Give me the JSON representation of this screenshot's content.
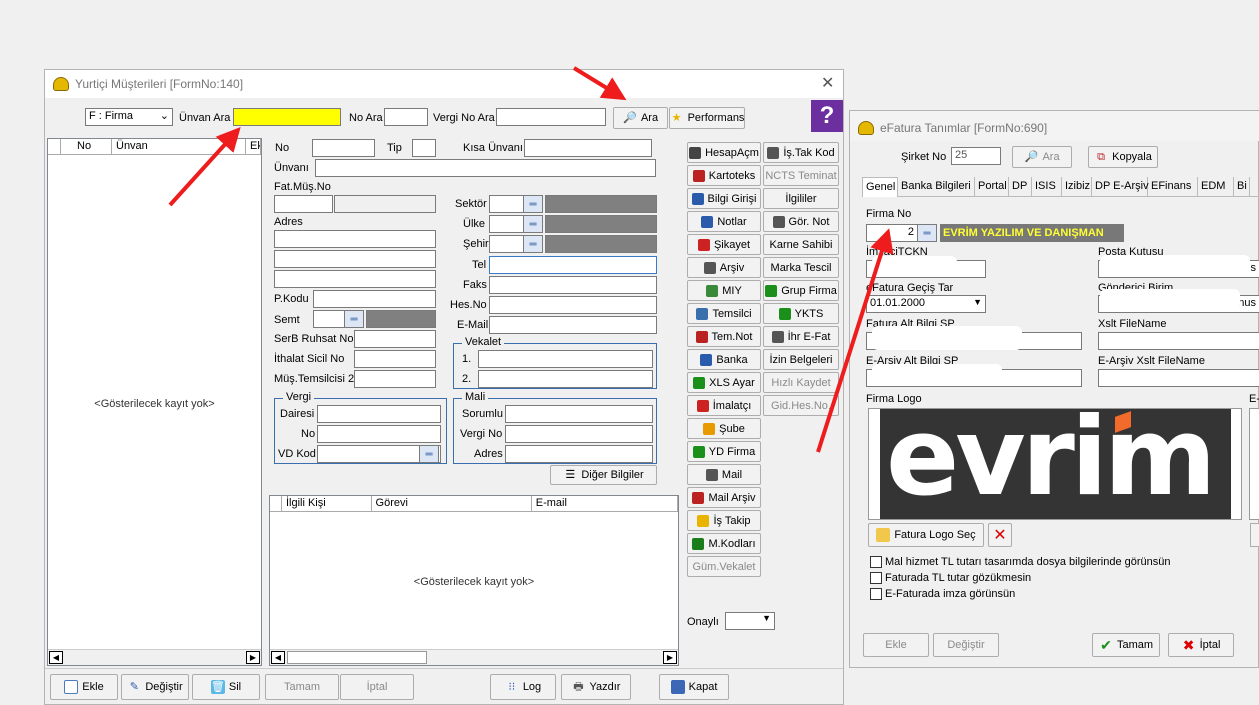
{
  "w1": {
    "title": "Yurtiçi Müşterileri [FormNo:140]",
    "filter_select": "F : Firma",
    "unvan_ara": "Ünvan Ara",
    "no_ara": "No Ara",
    "vergi_no_ara": "Vergi No Ara",
    "ara": "Ara",
    "performans": "Performans",
    "grid1_cols": [
      "No",
      "Ünvan",
      "Ek"
    ],
    "empty": "<Gösterilecek kayıt yok>",
    "f": {
      "no": "No",
      "tip": "Tip",
      "kisa_unvani": "Kısa Ünvanı",
      "unvani": "Ünvanı",
      "fat_mus_no": "Fat.Müş.No",
      "adres": "Adres",
      "sektor": "Sektör",
      "ulke": "Ülke",
      "sehir": "Şehir",
      "tel": "Tel",
      "faks": "Faks",
      "hes_no": "Hes.No",
      "email": "E-Mail",
      "pkodu": "P.Kodu",
      "semt": "Semt",
      "serb": "SerB Ruhsat No",
      "ithalat": "İthalat Sicil No",
      "mus_tem": "Müş.Temsilcisi 2",
      "vergi": "Vergi",
      "dairesi": "Dairesi",
      "no2": "No",
      "vd_kod": "VD Kod",
      "vekalet": "Vekalet",
      "v1": "1.",
      "v2": "2.",
      "mali": "Mali",
      "sorumlu": "Sorumlu",
      "vergi_no": "Vergi No",
      "adres2": "Adres",
      "diger": "Diğer Bilgiler"
    },
    "grid2_cols": [
      "İlgili Kişi",
      "Görevi",
      "E-mail"
    ],
    "side_left": [
      "HesapAçm",
      "Kartoteks",
      "Bilgi Girişi",
      "Notlar",
      "Şikayet",
      "Arşiv",
      "MIY",
      "Temsilci",
      "Tem.Not",
      "Banka",
      "XLS Ayar",
      "İmalatçı",
      "Şube",
      "YD Firma",
      "Mail",
      "Mail Arşiv",
      "İş Takip",
      "M.Kodları",
      "Güm.Vekalet"
    ],
    "side_right": [
      "İş.Tak Kod",
      "NCTS Teminat",
      "İlgililer",
      "Gör. Not",
      "Karne Sahibi",
      "Marka Tescil",
      "Grup Firma",
      "YKTS",
      "İhr E-Fat",
      "İzin Belgeleri",
      "Hızlı Kaydet",
      "Gid.Hes.No."
    ],
    "onayli": "Onaylı",
    "bottom": {
      "ekle": "Ekle",
      "degistir": "Değiştir",
      "sil": "Sil",
      "tamam": "Tamam",
      "iptal": "İptal",
      "log": "Log",
      "yazdir": "Yazdır",
      "kapat": "Kapat"
    }
  },
  "w2": {
    "title": "eFatura Tanımlar [FormNo:690]",
    "sirket_no": "Şirket No",
    "sirket_val": "25",
    "ara": "Ara",
    "kopyala": "Kopyala",
    "tabs": [
      "Genel",
      "Banka Bilgileri",
      "Portal",
      "DP",
      "ISIS",
      "Izibiz",
      "DP E-Arşiv",
      "EFinans",
      "EDM",
      "Bi"
    ],
    "firma_no": "Firma No",
    "firma_no_val": "2",
    "firma_name": "EVRİM YAZILIM VE DANIŞMAN",
    "imza": "İmzaciTCKN",
    "posta": "Posta Kutusu",
    "posta_tail": "s",
    "gecis": "eFatura Geçiş Tar",
    "gecis_val": "01.01.2000",
    "gonderici": "Gönderici Birim",
    "gonderici_tail": "edonus",
    "alt_bilgi": "Fatura Alt Bilgi SP",
    "xslt": "Xslt FileName",
    "earsiv_alt": "E-Arşiv Alt Bilgi SP",
    "earsiv_xslt": "E-Arşiv Xslt FileName",
    "firma_logo": "Firma Logo",
    "e_trunc": "E-",
    "logo_text": "evrim",
    "logo_sec": "Fatura Logo Seç",
    "checks": [
      "Mal hizmet TL tutarı tasarımda dosya bilgilerinde görünsün",
      "Faturada TL tutar gözükmesin",
      "E-Faturada imza görünsün"
    ],
    "ekle": "Ekle",
    "degistir": "Değiştir",
    "tamam": "Tamam",
    "iptal": "İptal"
  },
  "colors": {
    "accent": "#2d6db5",
    "highlight": "#ffff00",
    "arrow": "#ee1c1c"
  }
}
